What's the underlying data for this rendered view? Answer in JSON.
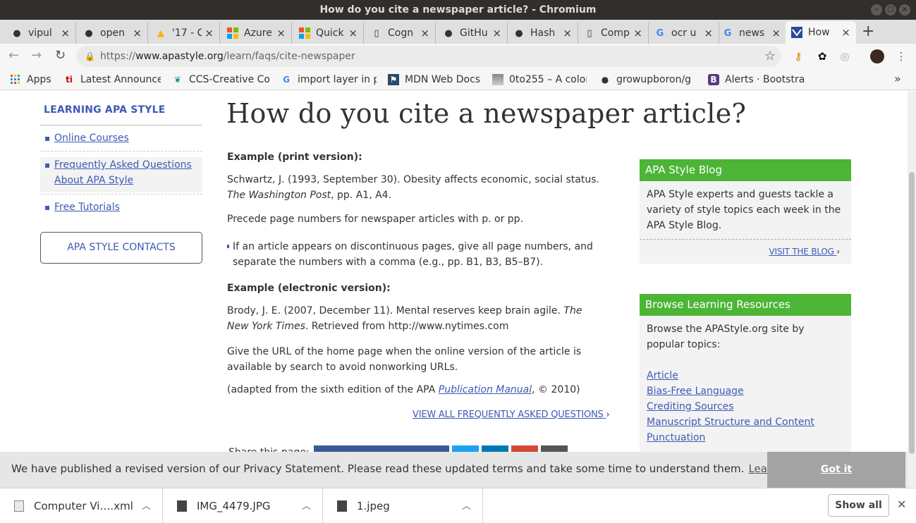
{
  "window": {
    "title": "How do you cite a newspaper article? - Chromium"
  },
  "tabs": [
    {
      "label": "vipul",
      "icon": "github-icon"
    },
    {
      "label": "open",
      "icon": "github-icon"
    },
    {
      "label": "'17 - C",
      "icon": "google-drive-icon"
    },
    {
      "label": "Azure",
      "icon": "microsoft-icon"
    },
    {
      "label": "Quick",
      "icon": "microsoft-icon"
    },
    {
      "label": "Cogn",
      "icon": "document-icon"
    },
    {
      "label": "GitHu",
      "icon": "github-icon"
    },
    {
      "label": "Hash",
      "icon": "github-icon"
    },
    {
      "label": "Comp",
      "icon": "document-icon"
    },
    {
      "label": "ocr u",
      "icon": "google-icon"
    },
    {
      "label": "news",
      "icon": "google-icon"
    },
    {
      "label": "How",
      "icon": "apa-icon"
    }
  ],
  "address": {
    "prefix": "https://",
    "host": "www.apastyle.org",
    "path": "/learn/faqs/cite-newspaper"
  },
  "bookmarks": [
    {
      "label": "Apps",
      "icon": "apps-grid-icon"
    },
    {
      "label": "Latest Announce",
      "icon": "ti-icon"
    },
    {
      "label": "CCS-Creative Co",
      "icon": "ccs-icon"
    },
    {
      "label": "import layer in p",
      "icon": "google-icon"
    },
    {
      "label": "MDN Web Docs",
      "icon": "mdn-icon"
    },
    {
      "label": "0to255 – A color",
      "icon": "0to255-icon"
    },
    {
      "label": "growupboron/g",
      "icon": "github-icon"
    },
    {
      "label": "Alerts · Bootstra",
      "icon": "bootstrap-icon"
    }
  ],
  "sidebar": {
    "heading": "LEARNING APA STYLE",
    "items": [
      {
        "label": "Online Courses"
      },
      {
        "label": "Frequently Asked Questions About APA Style"
      },
      {
        "label": "Free Tutorials"
      }
    ],
    "contacts_label": "APA STYLE CONTACTS"
  },
  "article": {
    "title": "How do you cite a newspaper article?",
    "ex_print_heading": "Example (print version):",
    "ex_print_ref_a": "Schwartz, J. (1993, September 30). Obesity affects economic, social status.",
    "ex_print_ref_italic": "The Washington Post",
    "ex_print_ref_b": ", pp. A1, A4.",
    "precede_note": "Precede page numbers for newspaper articles with p. or pp.",
    "bullet_note": "If an article appears on discontinuous pages, give all page numbers, and separate the numbers with a comma (e.g., pp. B1, B3, B5–B7).",
    "ex_elec_heading": "Example (electronic version):",
    "ex_elec_ref_a": "Brody, J. E. (2007, December 11). Mental reserves keep brain agile. ",
    "ex_elec_ref_italic": "The New York Times",
    "ex_elec_ref_b": ". Retrieved from http://www.nytimes.com",
    "url_note": "Give the URL of the home page when the online version of the article is available by search to avoid nonworking URLs.",
    "adapted_a": "(adapted from the sixth edition of the APA ",
    "adapted_link": "Publication Manual",
    "adapted_b": ", © 2010)",
    "view_all": "VIEW ALL FREQUENTLY ASKED QUESTIONS",
    "share_label": "Share this page:"
  },
  "blog_box": {
    "heading": "APA Style Blog",
    "body": "APA Style experts and guests tackle a variety of style topics each week in the APA Style Blog.",
    "link": "VISIT THE BLOG"
  },
  "resources_box": {
    "heading": "Browse Learning Resources",
    "body": "Browse the APAStyle.org site by popular topics:",
    "topics": [
      "Article",
      "Bias-Free Language",
      "Crediting Sources",
      "Manuscript Structure and Content",
      "Punctuation"
    ]
  },
  "cookie_banner": {
    "text": "We have published a revised version of our Privacy Statement. Please read these updated terms and take some time to understand them.",
    "learn_more": "Learn more",
    "got_it": "Got it"
  },
  "downloads": {
    "items": [
      {
        "name": "Computer Vi….xml"
      },
      {
        "name": "IMG_4479.JPG"
      },
      {
        "name": "1.jpeg"
      }
    ],
    "show_all": "Show all"
  },
  "colors": {
    "accent_green": "#4cb535",
    "link_blue": "#3e59b5"
  }
}
